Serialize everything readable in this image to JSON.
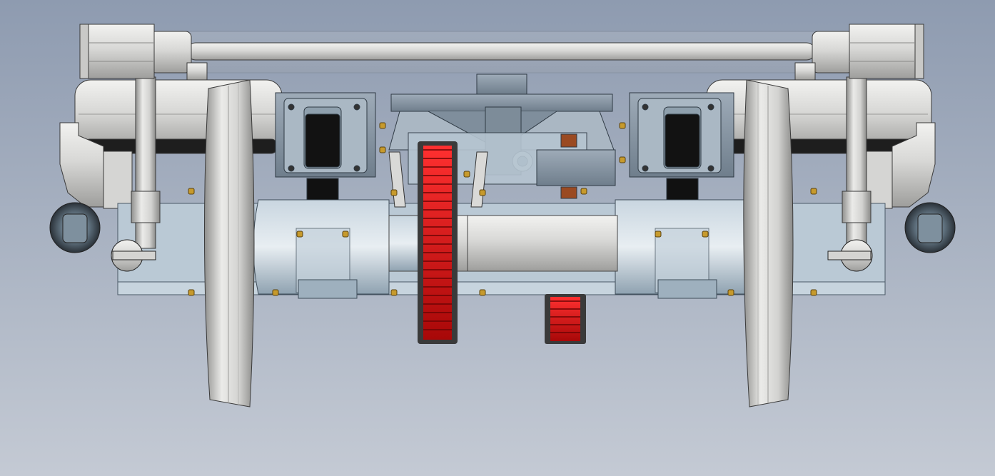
{
  "viewport": {
    "background_top": "#8e9bb0",
    "background_bottom": "#c4cad4"
  },
  "colors": {
    "steel_light": "#e4e4e2",
    "steel_mid": "#bfbfbd",
    "steel_dark": "#8a8a88",
    "blue_gray": "#a9bccb",
    "blue_gray_dark": "#6f8595",
    "slate": "#8796a4",
    "gear_red": "#d20f0f",
    "gear_red_dark": "#7a0505",
    "brass": "#c79a2c",
    "copper": "#9a4a22",
    "black": "#1b1b1b",
    "outline": "#2a2a2a"
  },
  "model": {
    "view": "front",
    "components": [
      {
        "name": "top-stabilizer-bar",
        "count": 1
      },
      {
        "name": "actuator-box",
        "count": 2
      },
      {
        "name": "air-spring",
        "count": 2
      },
      {
        "name": "wheel",
        "count": 2
      },
      {
        "name": "traction-motor-housing",
        "count": 2
      },
      {
        "name": "motor-mount-bracket",
        "count": 2
      },
      {
        "name": "center-axle",
        "count": 1
      },
      {
        "name": "center-bolster-frame",
        "count": 1
      },
      {
        "name": "drive-gear",
        "count": 2
      },
      {
        "name": "damper-eye",
        "count": 2
      },
      {
        "name": "vertical-strut",
        "count": 2
      }
    ]
  }
}
